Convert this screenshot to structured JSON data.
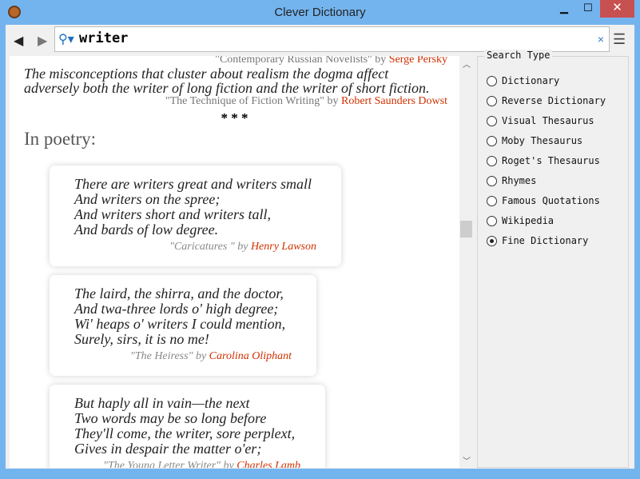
{
  "window": {
    "title": "Clever Dictionary",
    "minimize": "▁",
    "maximize": "☐",
    "close": "✕"
  },
  "toolbar": {
    "back": "◀",
    "forward": "▶",
    "search_icon": "⚲▾",
    "query": "writer",
    "clear": "×",
    "menu": "☰"
  },
  "content": {
    "top_source": {
      "title": "\"Contemporary Russian Novelists\"",
      "by": "by",
      "author": "Serge Persky"
    },
    "quote": {
      "lines": [
        "The misconceptions that cluster about realism the dogma affect",
        "adversely both the writer of long fiction and the writer of short fiction."
      ],
      "title": "\"The Technique of Fiction Writing\"",
      "by": "by",
      "author": "Robert Saunders Dowst"
    },
    "separator": "* * *",
    "heading": "In poetry:",
    "poems": [
      {
        "lines": [
          "There are writers great and writers small",
          "And writers on the spree;",
          "And writers short and writers tall,",
          "And bards of low degree."
        ],
        "title": "\"Caricatures \"",
        "by": "by",
        "author": "Henry Lawson"
      },
      {
        "lines": [
          "The laird, the shirra, and the doctor,",
          "And twa-three lords o' high degree;",
          "Wi' heaps o' writers I could mention,",
          "Surely, sirs, it is no me!"
        ],
        "title": "\"The Heiress\"",
        "by": "by",
        "author": "Carolina Oliphant"
      },
      {
        "lines": [
          "But haply all in vain—the next",
          "Two words may be so long before",
          "They'll come, the writer, sore perplext,",
          "Gives in despair the matter o'er;"
        ],
        "title": "\"The Young Letter Writer\"",
        "by": "by",
        "author": "Charles Lamb"
      }
    ]
  },
  "search_type": {
    "label": "Search Type",
    "selected": "Fine Dictionary",
    "options": [
      "Dictionary",
      "Reverse Dictionary",
      "Visual Thesaurus",
      "Moby Thesaurus",
      "Roget's Thesaurus",
      "Rhymes",
      "Famous Quotations",
      "Wikipedia",
      "Fine Dictionary"
    ]
  }
}
